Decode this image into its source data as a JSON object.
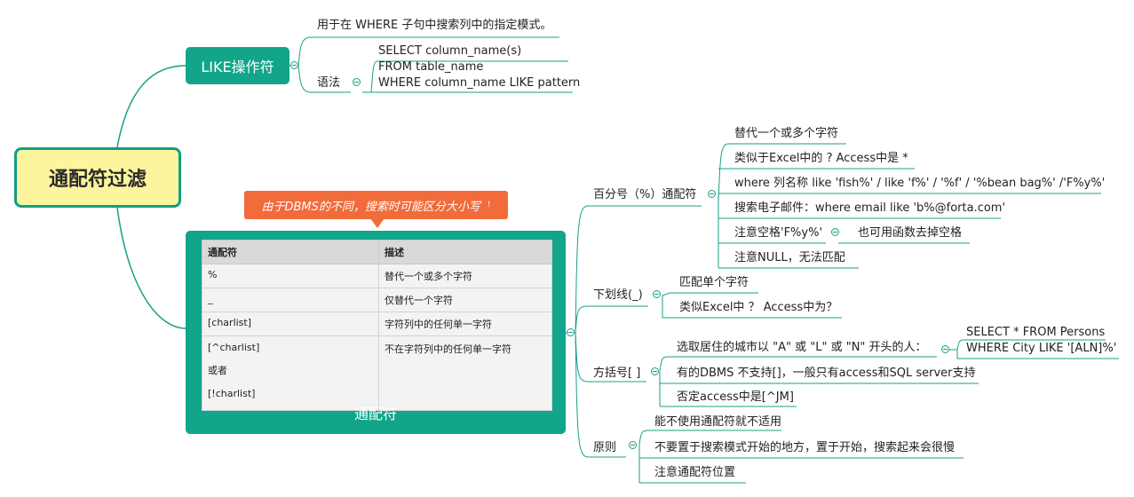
{
  "root": {
    "label": "通配符过滤"
  },
  "like": {
    "label": "LIKE操作符",
    "desc": "用于在 WHERE 子句中搜索列中的指定模式。",
    "syntax_label": "语法",
    "syntax_lines": [
      "SELECT column_name(s)",
      "FROM table_name",
      "WHERE column_name LIKE pattern"
    ]
  },
  "wildcard": {
    "callout": "由于DBMS的不同，搜索时可能区分大小写",
    "callout_mark": "!",
    "caption": "通配符",
    "table": {
      "headers": [
        "通配符",
        "描述"
      ],
      "rows": [
        [
          "%",
          "替代一个或多个字符"
        ],
        [
          "_",
          "仅替代一个字符"
        ],
        [
          "[charlist]",
          "字符列中的任何单一字符"
        ],
        [
          "[^charlist]",
          "不在字符列中的任何单一字符"
        ],
        [
          "或者",
          ""
        ],
        [
          "[!charlist]",
          ""
        ]
      ]
    }
  },
  "percent": {
    "label": "百分号（%）通配符",
    "items": [
      "替代一个或多个字符",
      "类似于Excel中的 ? Access中是 *",
      "where 列名称 like 'fish%' / like 'f%' / '%f' / '%bean bag%' /'F%y%'",
      "搜索电子邮件：where email like 'b%@forta.com'",
      "注意空格'F%y%'",
      "注意NULL，无法匹配"
    ],
    "space_note": "也可用函数去掉空格"
  },
  "underscore": {
    "label": "下划线(_)",
    "items": [
      "匹配单个字符",
      "类似Excel中 ？ Access中为？"
    ]
  },
  "brackets": {
    "label": "方括号[ ]",
    "items": [
      "选取居住的城市以 \"A\" 或 \"L\" 或 \"N\" 开头的人：",
      "有的DBMS 不支持[]，一般只有access和SQL server支持",
      "否定access中是[^JM]"
    ],
    "sql": [
      "SELECT * FROM Persons",
      "WHERE City LIKE '[ALN]%'"
    ]
  },
  "principles": {
    "label": "原则",
    "items": [
      "能不使用通配符就不适用",
      "不要置于搜索模式开始的地方，置于开始，搜索起来会很慢",
      "注意通配符位置"
    ]
  },
  "colors": {
    "branch": "#1a9f89",
    "root_fill": "#fdf59d",
    "node_fill": "#12a58a",
    "callout": "#f26b3a"
  }
}
